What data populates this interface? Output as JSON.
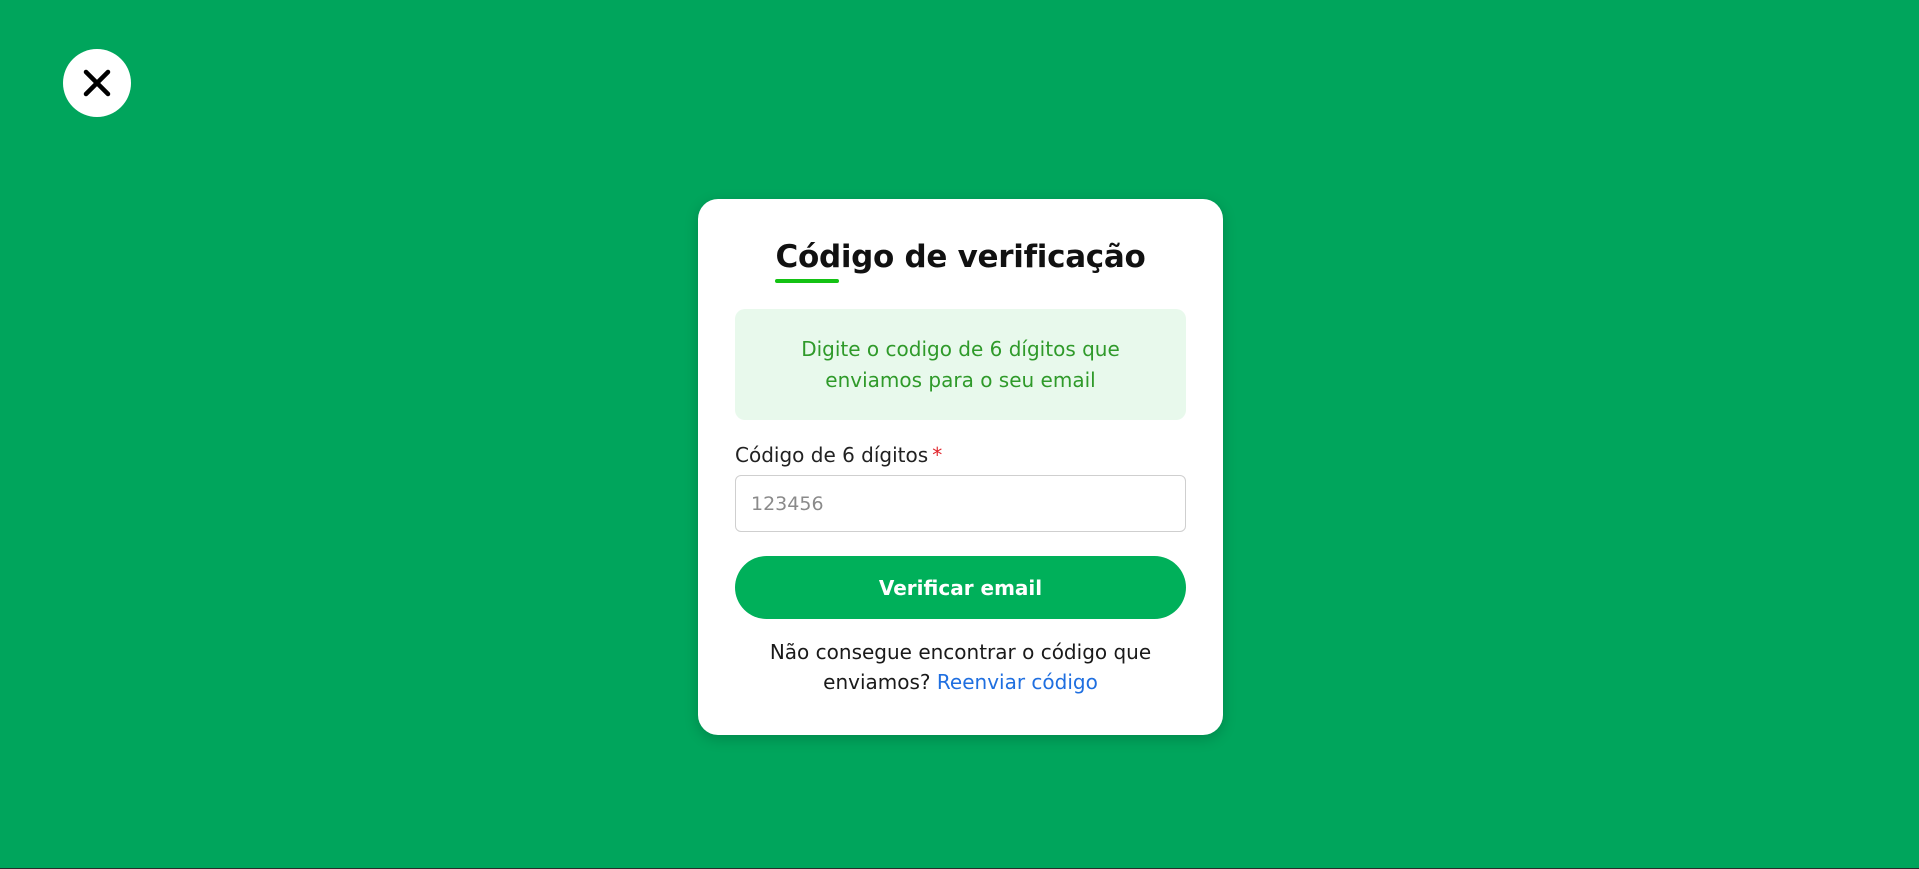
{
  "close_button": {
    "icon": "close-icon"
  },
  "card": {
    "title": "Código de verificação",
    "info_message": "Digite o codigo de 6 dígitos que enviamos para o seu email",
    "field": {
      "label": "Código de 6 dígitos",
      "required_mark": "*",
      "placeholder": "123456",
      "value": ""
    },
    "submit_label": "Verificar email",
    "resend_prompt": "Não consegue encontrar o código que enviamos?",
    "resend_link": "Reenviar código"
  },
  "colors": {
    "background": "#00a55c",
    "button": "#00b05a",
    "info_bg": "#e8f9ec",
    "info_text": "#2f9a2a",
    "link": "#1f6fe0",
    "required": "#e0242b",
    "title_underline": "#14c214"
  }
}
